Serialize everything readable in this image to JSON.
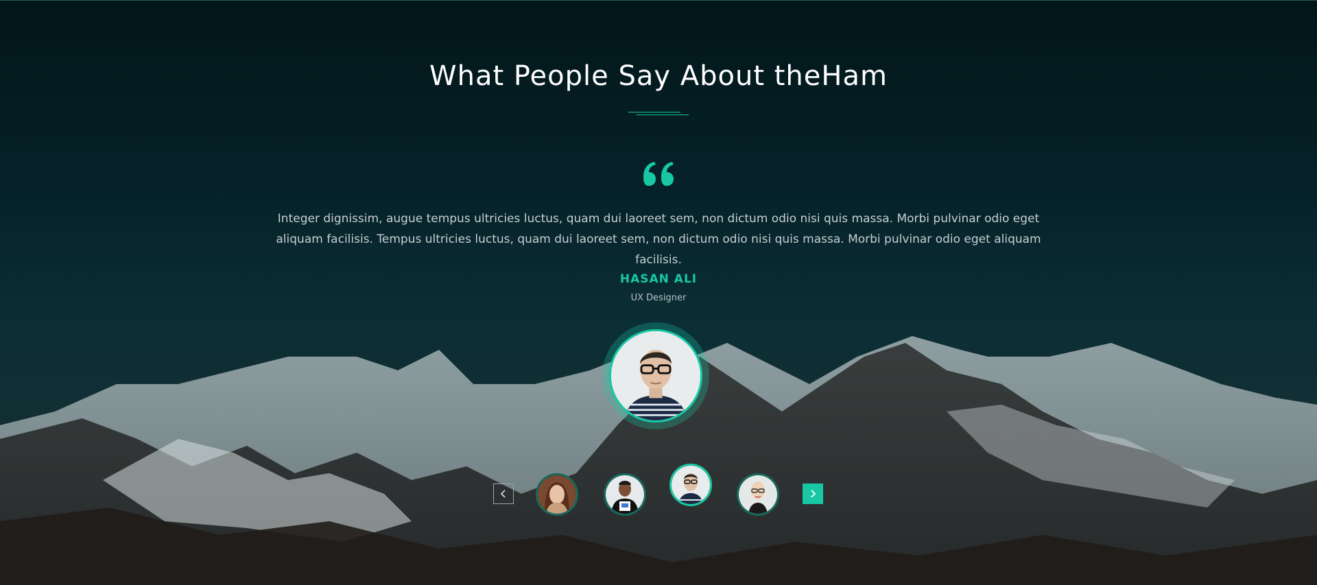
{
  "section": {
    "title": "What People Say About theHam",
    "accent_color": "#18c8a4",
    "background_image": "snowy-mountains-photo"
  },
  "testimonial": {
    "quote_icon": "quote-icon",
    "text": "Integer dignissim, augue tempus ultricies luctus, quam dui laoreet sem, non dictum odio nisi quis massa. Morbi pulvinar odio eget aliquam facilisis. Tempus ultricies luctus, quam dui laoreet sem, non dictum odio nisi quis massa. Morbi pulvinar odio eget aliquam facilisis.",
    "author_name": "HASAN ALI",
    "author_role": "UX Designer",
    "author_avatar": "man-with-glasses-avatar"
  },
  "carousel": {
    "prev_icon": "chevron-left-icon",
    "next_icon": "chevron-right-icon",
    "thumbnails": [
      {
        "avatar": "woman-with-long-hair-avatar",
        "active": false
      },
      {
        "avatar": "man-in-tshirt-avatar",
        "active": false
      },
      {
        "avatar": "man-with-glasses-avatar",
        "active": true
      },
      {
        "avatar": "bald-woman-with-glasses-avatar",
        "active": false
      }
    ]
  }
}
